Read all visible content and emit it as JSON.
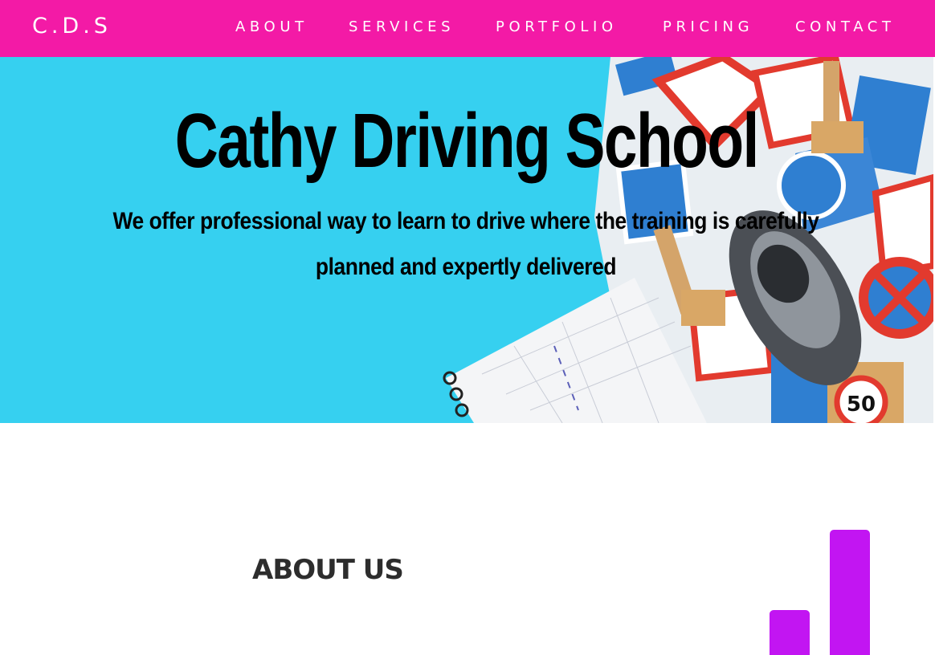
{
  "nav": {
    "brand": "C.D.S",
    "links": [
      "ABOUT",
      "SERVICES",
      "PORTFOLIO",
      "PRICING",
      "CONTACT"
    ]
  },
  "hero": {
    "title": "Cathy Driving School",
    "subtitle": "We offer professional way to learn to drive where the training is carefully planned and expertly delivered",
    "sign_text": "50"
  },
  "about": {
    "heading": "ABOUT US"
  },
  "colors": {
    "nav_bg": "#f31aa6",
    "hero_bg": "#36d0f0",
    "accent_bars": "#c215f2",
    "heading": "#2d2d2d"
  }
}
